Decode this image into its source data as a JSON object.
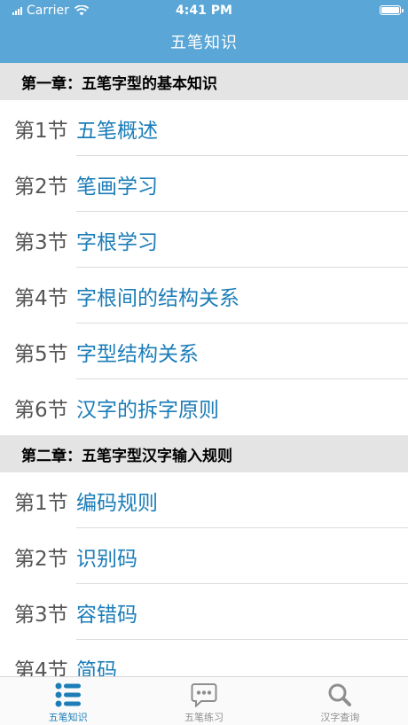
{
  "status_bar": {
    "carrier": "Carrier",
    "time": "4:41 PM"
  },
  "nav": {
    "title": "五笔知识"
  },
  "sections": [
    {
      "title": "第一章：五笔字型的基本知识",
      "items": [
        {
          "num": "第1节",
          "title": "五笔概述"
        },
        {
          "num": "第2节",
          "title": "笔画学习"
        },
        {
          "num": "第3节",
          "title": "字根学习"
        },
        {
          "num": "第4节",
          "title": "字根间的结构关系"
        },
        {
          "num": "第5节",
          "title": "字型结构关系"
        },
        {
          "num": "第6节",
          "title": "汉字的拆字原则"
        }
      ]
    },
    {
      "title": "第二章：五笔字型汉字输入规则",
      "items": [
        {
          "num": "第1节",
          "title": "编码规则"
        },
        {
          "num": "第2节",
          "title": "识别码"
        },
        {
          "num": "第3节",
          "title": "容错码"
        },
        {
          "num": "第4节",
          "title": "简码"
        }
      ]
    }
  ],
  "tabbar": {
    "tabs": [
      {
        "label": "五笔知识",
        "icon": "list-icon",
        "active": true
      },
      {
        "label": "五笔练习",
        "icon": "chat-bubble-icon",
        "active": false
      },
      {
        "label": "汉字查询",
        "icon": "search-icon",
        "active": false
      }
    ]
  },
  "colors": {
    "header": "#5AA6D6",
    "accent": "#1C7DB8",
    "section_bg": "#E4E4E4"
  }
}
